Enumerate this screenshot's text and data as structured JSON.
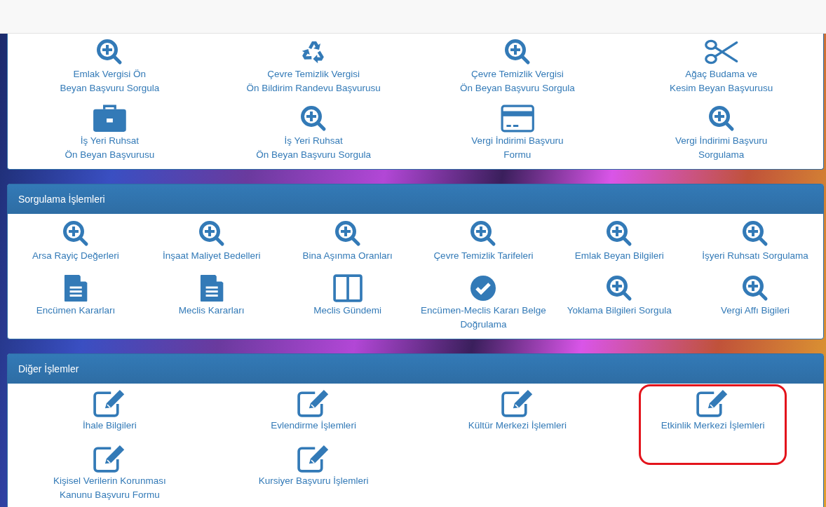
{
  "sections": [
    {
      "items": [
        {
          "kind": "zoom",
          "label": "Emlak Vergisi Ön\nBeyan Başvuru Sorgula",
          "highlighted": false
        },
        {
          "kind": "recycle",
          "label": "Çevre Temizlik Vergisi\nÖn Bildirim Randevu Başvurusu",
          "highlighted": false
        },
        {
          "kind": "zoom",
          "label": "Çevre Temizlik Vergisi\nÖn Beyan Başvuru Sorgula",
          "highlighted": false
        },
        {
          "kind": "scissors",
          "label": "Ağaç Budama ve\nKesim Beyan Başvurusu",
          "highlighted": false
        },
        {
          "kind": "briefcase",
          "label": "İş Yeri Ruhsat\nÖn Beyan Başvurusu",
          "highlighted": false
        },
        {
          "kind": "zoom",
          "label": "İş Yeri Ruhsat\nÖn Beyan Başvuru Sorgula",
          "highlighted": false
        },
        {
          "kind": "card",
          "label": "Vergi İndirimi Başvuru\nFormu",
          "highlighted": false
        },
        {
          "kind": "zoom",
          "label": "Vergi İndirimi Başvuru\nSorgulama",
          "highlighted": false
        }
      ]
    },
    {
      "title": "Sorgulama İşlemleri",
      "items": [
        {
          "kind": "zoom",
          "label": "Arsa Rayiç Değerleri",
          "highlighted": false
        },
        {
          "kind": "zoom",
          "label": "İnşaat Maliyet Bedelleri",
          "highlighted": false
        },
        {
          "kind": "zoom",
          "label": "Bina Aşınma Oranları",
          "highlighted": false
        },
        {
          "kind": "zoom",
          "label": "Çevre Temizlik Tarifeleri",
          "highlighted": false
        },
        {
          "kind": "zoom",
          "label": "Emlak Beyan Bilgileri",
          "highlighted": false
        },
        {
          "kind": "zoom",
          "label": "İşyeri Ruhsatı Sorgulama",
          "highlighted": false
        },
        {
          "kind": "file",
          "label": "Encümen Kararları",
          "highlighted": false
        },
        {
          "kind": "file",
          "label": "Meclis Kararları",
          "highlighted": false
        },
        {
          "kind": "columns",
          "label": "Meclis Gündemi",
          "highlighted": false
        },
        {
          "kind": "check",
          "label": "Encümen-Meclis Kararı Belge\nDoğrulama",
          "highlighted": false
        },
        {
          "kind": "zoom",
          "label": "Yoklama Bilgileri Sorgula",
          "highlighted": false
        },
        {
          "kind": "zoom",
          "label": "Vergi Affı Bigileri",
          "highlighted": false
        }
      ]
    },
    {
      "title": "Diğer İşlemler",
      "items": [
        {
          "kind": "edit",
          "label": "İhale Bilgileri",
          "highlighted": false
        },
        {
          "kind": "edit",
          "label": "Evlendirme İşlemleri",
          "highlighted": false
        },
        {
          "kind": "edit",
          "label": "Kültür Merkezi İşlemleri",
          "highlighted": false
        },
        {
          "kind": "edit",
          "label": "Etkinlik Merkezi İşlemleri",
          "highlighted": true
        },
        {
          "kind": "edit",
          "label": "Kişisel Verilerin Korunması\nKanunu Başvuru Formu",
          "highlighted": false
        },
        {
          "kind": "edit",
          "label": "Kursiyer Başvuru İşlemleri",
          "highlighted": false
        }
      ]
    }
  ]
}
